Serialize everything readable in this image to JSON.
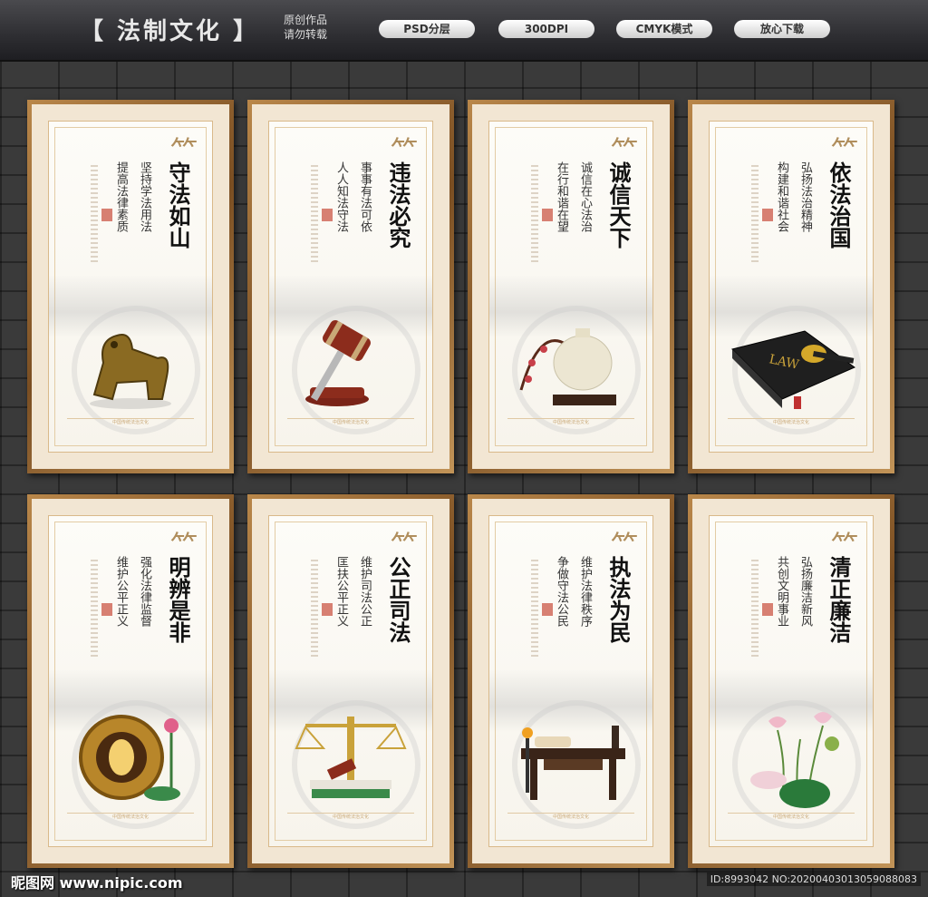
{
  "header": {
    "title": "【 法制文化 】",
    "subtitle_line1": "原创作品",
    "subtitle_line2": "请勿转载",
    "pills": [
      "PSD分层",
      "300DPI",
      "CMYK模式",
      "放心下载"
    ]
  },
  "posters": [
    {
      "heading": "守法如山",
      "col1": "坚持学法用法",
      "col2": "提高法律素质",
      "object": "bronze-pixiu-icon"
    },
    {
      "heading": "违法必究",
      "col1": "事事有法可依",
      "col2": "人人知法守法",
      "object": "gavel-icon"
    },
    {
      "heading": "诚信天下",
      "col1": "诚信在心法治",
      "col2": "在行和谐在望",
      "object": "jade-censer-icon"
    },
    {
      "heading": "依法治国",
      "col1": "弘扬法治精神",
      "col2": "构建和谐社会",
      "object": "law-book-icon"
    },
    {
      "heading": "明辨是非",
      "col1": "强化法律监督",
      "col2": "维护公平正义",
      "object": "gold-plate-icon"
    },
    {
      "heading": "公正司法",
      "col1": "维护司法公正",
      "col2": "匡扶公平正义",
      "object": "scales-icon"
    },
    {
      "heading": "执法为民",
      "col1": "维护法律秩序",
      "col2": "争做守法公民",
      "object": "desk-scroll-icon"
    },
    {
      "heading": "清正廉洁",
      "col1": "弘扬廉洁新风",
      "col2": "共创文明事业",
      "object": "lotus-icon"
    }
  ],
  "footer_deco_text": "中国传统法治文化",
  "watermark": {
    "left": "昵图网 www.nipic.com",
    "right": "ID:8993042 NO:20200403013059088083"
  }
}
